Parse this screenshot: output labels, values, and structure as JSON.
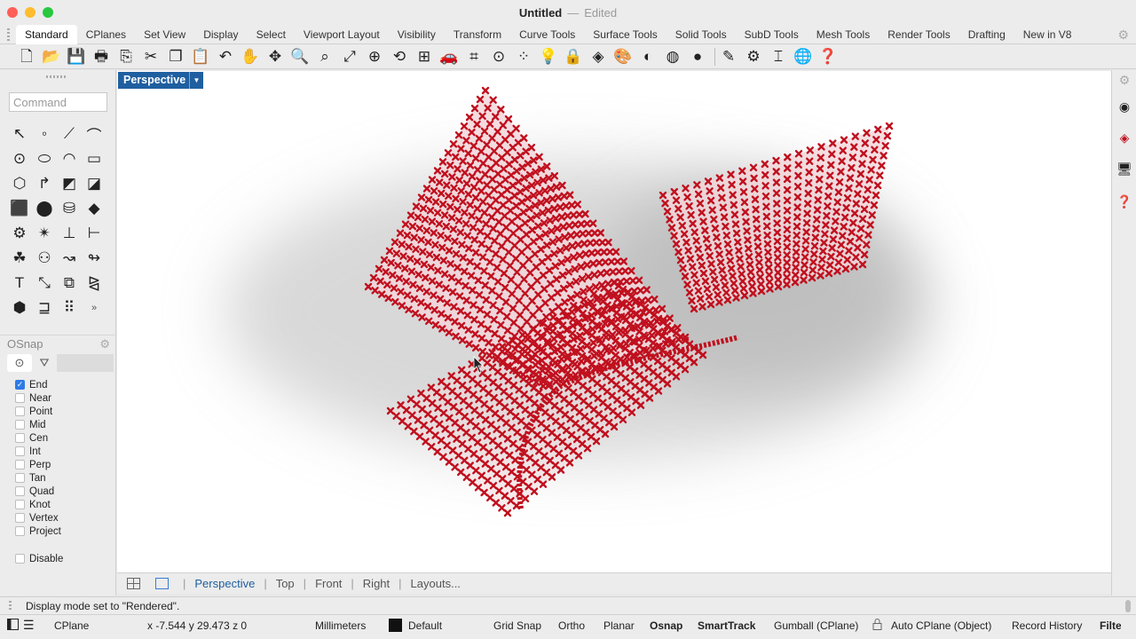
{
  "window": {
    "title": "Untitled",
    "separator": "—",
    "status": "Edited"
  },
  "tabs": [
    "Standard",
    "CPlanes",
    "Set View",
    "Display",
    "Select",
    "Viewport Layout",
    "Visibility",
    "Transform",
    "Curve Tools",
    "Surface Tools",
    "Solid Tools",
    "SubD Tools",
    "Mesh Tools",
    "Render Tools",
    "Drafting",
    "New in V8"
  ],
  "active_tab": "Standard",
  "command": {
    "placeholder": "Command"
  },
  "osnap": {
    "title": "OSnap",
    "items": [
      {
        "label": "End",
        "checked": true
      },
      {
        "label": "Near",
        "checked": false
      },
      {
        "label": "Point",
        "checked": false
      },
      {
        "label": "Mid",
        "checked": false
      },
      {
        "label": "Cen",
        "checked": false
      },
      {
        "label": "Int",
        "checked": false
      },
      {
        "label": "Perp",
        "checked": false
      },
      {
        "label": "Tan",
        "checked": false
      },
      {
        "label": "Quad",
        "checked": false
      },
      {
        "label": "Knot",
        "checked": false
      },
      {
        "label": "Vertex",
        "checked": false
      },
      {
        "label": "Project",
        "checked": false
      }
    ],
    "disable_label": "Disable"
  },
  "viewport": {
    "label": "Perspective"
  },
  "viewport_tabs": [
    "Perspective",
    "Top",
    "Front",
    "Right",
    "Layouts..."
  ],
  "active_viewport_tab": "Perspective",
  "command_line": {
    "text": "Display mode set to \"Rendered\"."
  },
  "status": {
    "cplane": "CPlane",
    "coords": "x -7.544  y 29.473  z 0",
    "units": "Millimeters",
    "layer": "Default",
    "grid_snap": "Grid Snap",
    "ortho": "Ortho",
    "planar": "Planar",
    "osnap": "Osnap",
    "smarttrack": "SmartTrack",
    "gumball": "Gumball (CPlane)",
    "auto_cplane": "Auto CPlane (Object)",
    "record_history": "Record History",
    "filter": "Filter"
  },
  "colors": {
    "accent": "#1f5fa0",
    "point": "#c0101e",
    "surface": "#f2d6da",
    "checkbox": "#2d7be5"
  }
}
